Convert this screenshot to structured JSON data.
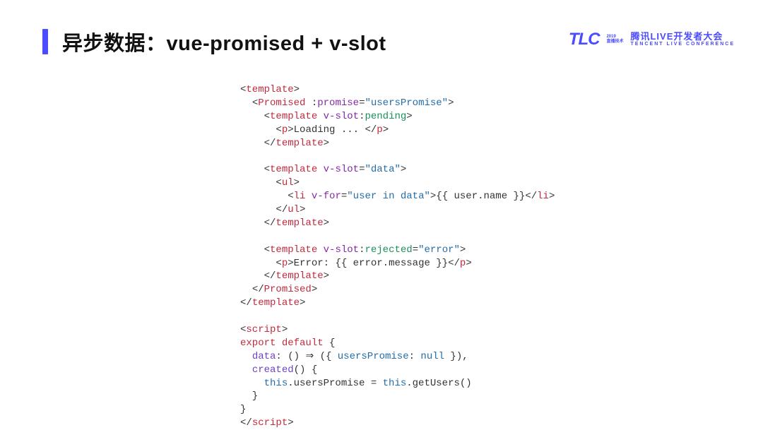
{
  "header": {
    "title": "异步数据：vue-promised + v-slot"
  },
  "logo": {
    "tlc": "TLC",
    "badge_year": "2019",
    "badge_hint": "直播技术",
    "main": "腾讯LIVE开发者大会",
    "sub": "TENCENT LIVE CONFERENCE"
  },
  "code": {
    "tpl_open": "template",
    "promised": "Promised",
    "promise_attr": "promise",
    "promise_val": "\"usersPromise\"",
    "vslot": "v-slot",
    "pending": "pending",
    "slot_data": "\"data\"",
    "rejected": "rejected",
    "error_var": "\"error\"",
    "loading_text": "Loading ... ",
    "p_tag": "p",
    "ul_tag": "ul",
    "li_tag": "li",
    "vfor_attr": "v-for",
    "vfor_val": "\"user in data\"",
    "interp_user": "{{ user.name }}",
    "error_prefix": "Error: ",
    "interp_err": "{{ error.message }}",
    "script_tag": "script",
    "export_kw": "export",
    "default_kw": "default",
    "data_key": "data",
    "arrow": "⇒",
    "users_promise_key": "usersPromise",
    "null_lit": "null",
    "created_key": "created",
    "this_kw": "this",
    "get_users": "getUsers"
  }
}
